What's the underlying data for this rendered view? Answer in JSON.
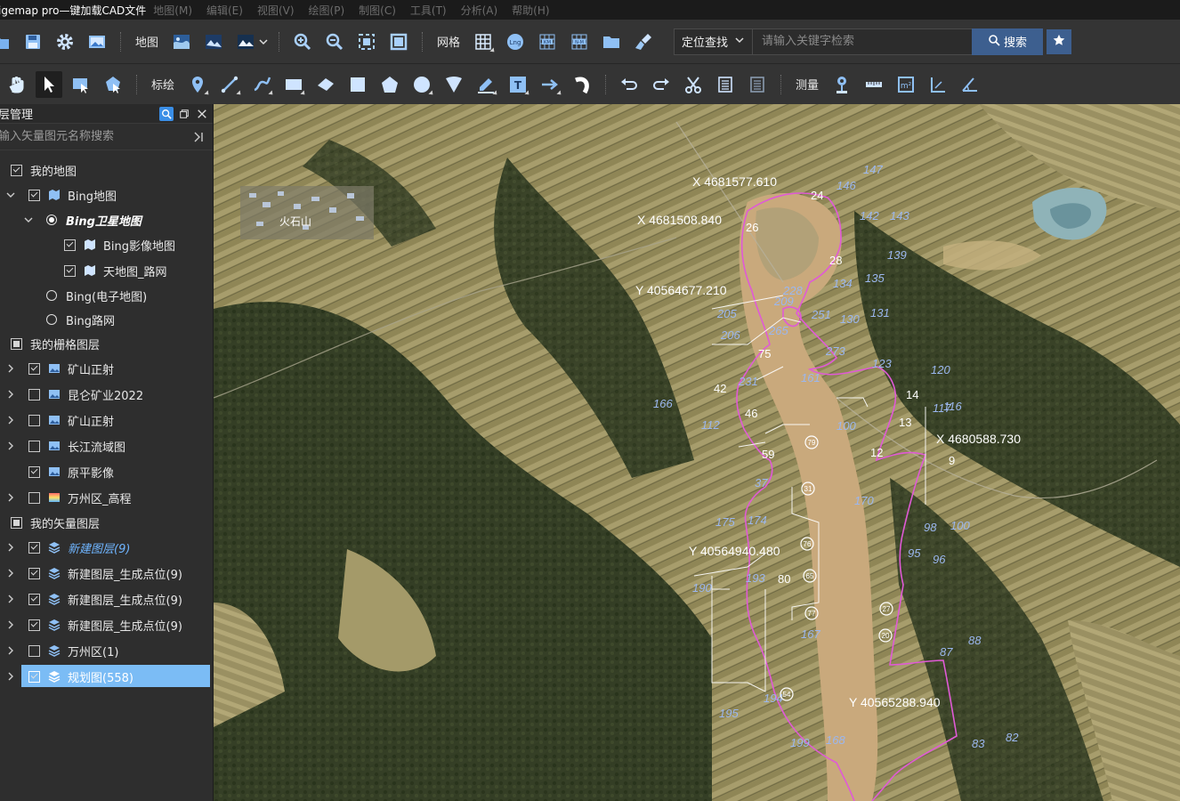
{
  "window": {
    "title": "igemap pro—键加载CAD文件",
    "menus": [
      "地图(M)",
      "编辑(E)",
      "视图(V)",
      "绘图(P)",
      "制图(C)",
      "工具(T)",
      "分析(A)",
      "帮助(H)"
    ]
  },
  "toolbar1": {
    "map_label": "地图",
    "grid_label": "网格",
    "search_mode": "定位查找",
    "search_placeholder": "请输入关键字检索",
    "search_button": "搜索"
  },
  "toolbar2": {
    "annotate_label": "标绘",
    "measure_label": "测量"
  },
  "panel": {
    "title": "层管理",
    "search_placeholder": "输入矢量图元名称搜索",
    "items": [
      {
        "label": "我的地图"
      },
      {
        "label": "Bing地图"
      },
      {
        "label": "Bing卫星地图"
      },
      {
        "label": "Bing影像地图"
      },
      {
        "label": "天地图_路网"
      },
      {
        "label": "Bing(电子地图)"
      },
      {
        "label": "Bing路网"
      },
      {
        "label": "我的栅格图层"
      },
      {
        "label": "矿山正射"
      },
      {
        "label": "昆仑矿业2022"
      },
      {
        "label": "矿山正射"
      },
      {
        "label": "长江流域图"
      },
      {
        "label": "原平影像"
      },
      {
        "label": "万州区_高程"
      },
      {
        "label": "我的矢量图层"
      },
      {
        "label": "新建图层(9)"
      },
      {
        "label": "新建图层_生成点位(9)"
      },
      {
        "label": "新建图层_生成点位(9)"
      },
      {
        "label": "新建图层_生成点位(9)"
      },
      {
        "label": "万州区(1)"
      },
      {
        "label": "规划图(558)"
      }
    ]
  },
  "map": {
    "place_name": "火石山",
    "coordinates": [
      {
        "text": "X 4681577.610"
      },
      {
        "text": "X 4681508.840"
      },
      {
        "text": "Y 40564677.210"
      },
      {
        "text": "X 4680588.730"
      },
      {
        "text": "Y 40564940.480"
      },
      {
        "text": "Y 40565288.940"
      }
    ],
    "white_points": [
      "24",
      "26",
      "28",
      "75",
      "42",
      "46",
      "59",
      "14",
      "13",
      "12",
      "9",
      "80"
    ],
    "blue_points": [
      "147",
      "146",
      "142",
      "143",
      "139",
      "134",
      "135",
      "209",
      "228",
      "205",
      "251",
      "130",
      "131",
      "206",
      "273",
      "123",
      "120",
      "117",
      "116",
      "231",
      "161",
      "166",
      "112",
      "100",
      "170",
      "37",
      "175",
      "174",
      "98",
      "100",
      "95",
      "96",
      "193",
      "190",
      "167",
      "87",
      "88",
      "194",
      "195",
      "199",
      "168",
      "83",
      "82",
      "265"
    ],
    "circle_markers": [
      "79",
      "31",
      "76",
      "65",
      "77",
      "27",
      "20",
      "54"
    ],
    "colors": {
      "boundary": "#e05ad6",
      "line": "#ffffff"
    }
  }
}
